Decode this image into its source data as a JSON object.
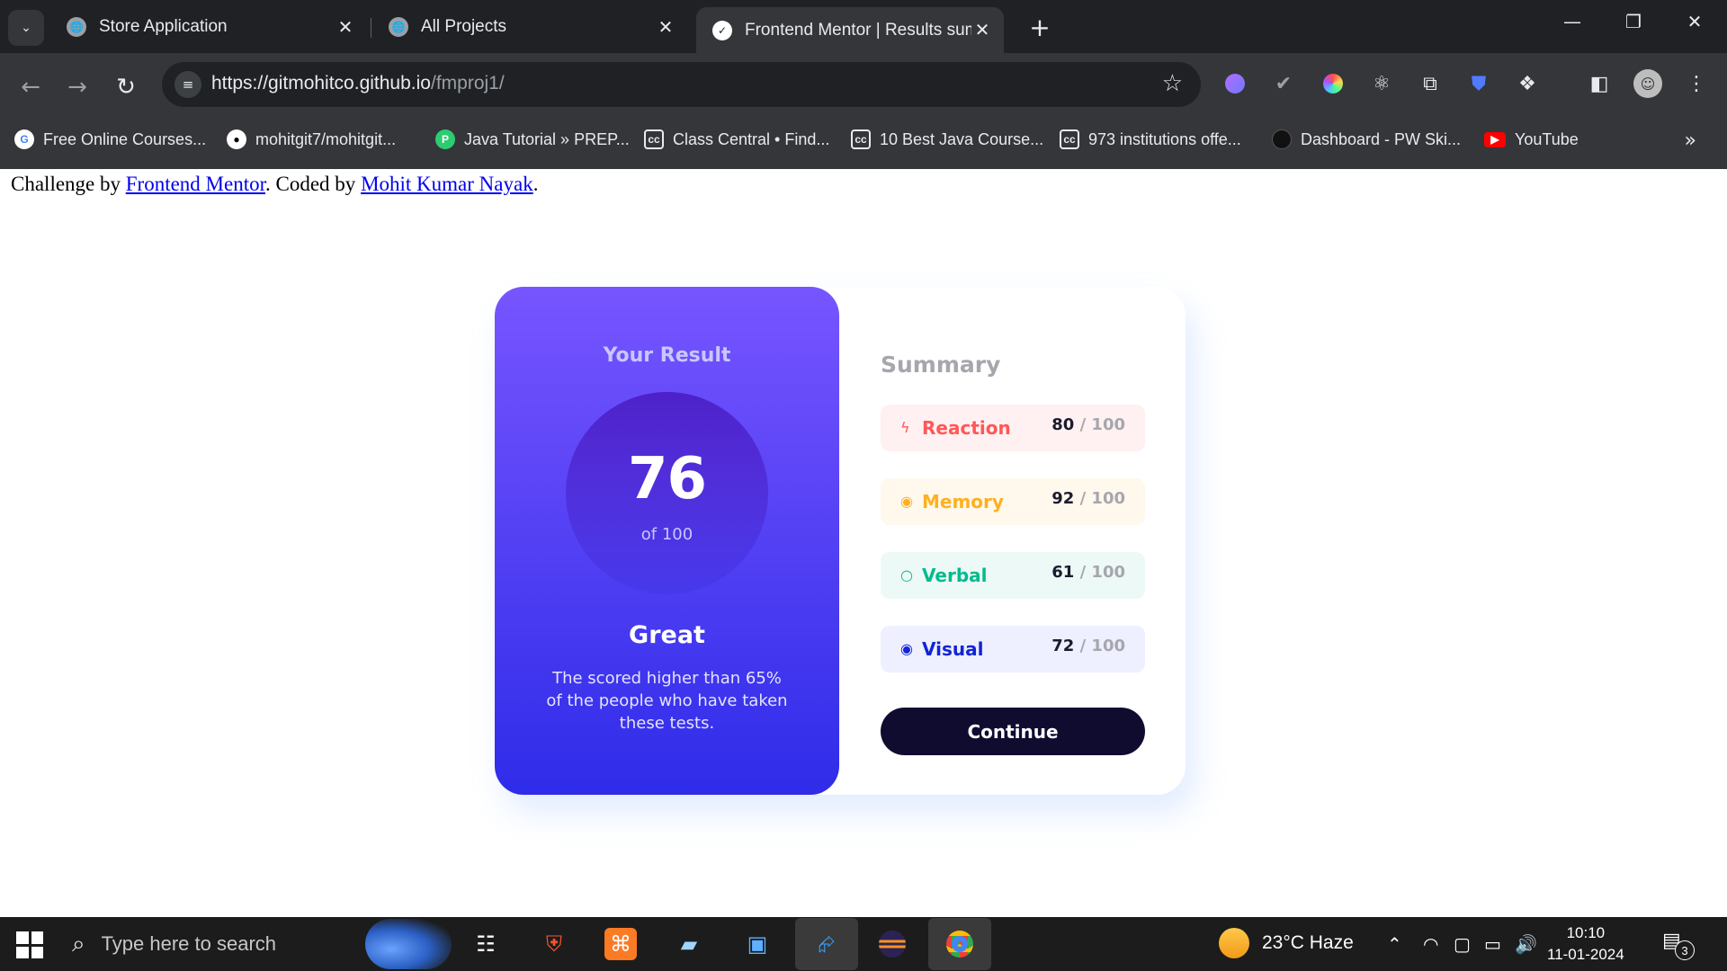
{
  "browser": {
    "tabs": [
      {
        "title": "Store Application",
        "icon": "globe-icon",
        "active": false
      },
      {
        "title": "All Projects",
        "icon": "globe-icon",
        "active": false
      },
      {
        "title": "Frontend Mentor | Results summ",
        "icon": "frontend-mentor-icon",
        "active": true
      }
    ],
    "url_host": "https://gitmohitco.github.io",
    "url_path": "/fmproj1/",
    "bookmarks": [
      {
        "label": "Free Online Courses...",
        "icon": "google-icon",
        "color": "#4285f4"
      },
      {
        "label": "mohitgit7/mohitgit...",
        "icon": "github-icon",
        "color": "#ffffff"
      },
      {
        "label": "Java Tutorial » PREP...",
        "icon": "prepinsta-icon",
        "color": "#2ecc71"
      },
      {
        "label": "Class Central • Find...",
        "icon": "classcentral-icon",
        "color": "#ffffff"
      },
      {
        "label": "10 Best Java Course...",
        "icon": "classcentral-icon",
        "color": "#ffffff"
      },
      {
        "label": "973 institutions offe...",
        "icon": "classcentral-icon",
        "color": "#ffffff"
      },
      {
        "label": "Dashboard - PW Ski...",
        "icon": "pwskills-icon",
        "color": "#333333"
      },
      {
        "label": "YouTube",
        "icon": "youtube-icon",
        "color": "#ff0000"
      }
    ]
  },
  "page": {
    "attribution": {
      "prefix": "Challenge by ",
      "link1": "Frontend Mentor",
      "middle": ". Coded by ",
      "link2": "Mohit Kumar Nayak",
      "suffix": "."
    },
    "result": {
      "title": "Your Result",
      "score": "76",
      "score_of": "of 100",
      "grade": "Great",
      "description": "The scored higher than 65% of the people who have taken these tests."
    },
    "summary": {
      "title": "Summary",
      "categories": [
        {
          "label": "Reaction",
          "score": "80",
          "total": "100",
          "icon": "lightning-icon",
          "color": "#ff5757",
          "bg": "#fff1f1"
        },
        {
          "label": "Memory",
          "score": "92",
          "total": "100",
          "icon": "brain-icon",
          "color": "#ffb01f",
          "bg": "#fff8ec"
        },
        {
          "label": "Verbal",
          "score": "61",
          "total": "100",
          "icon": "chat-icon",
          "color": "#00bb8f",
          "bg": "#edf9f6"
        },
        {
          "label": "Visual",
          "score": "72",
          "total": "100",
          "icon": "eye-icon",
          "color": "#1125d6",
          "bg": "#eeefff"
        }
      ],
      "slash": "/",
      "continue_label": "Continue"
    }
  },
  "taskbar": {
    "search_placeholder": "Type here to search",
    "weather": "23°C  Haze",
    "time": "10:10",
    "date": "11-01-2024",
    "notification_count": "3"
  }
}
